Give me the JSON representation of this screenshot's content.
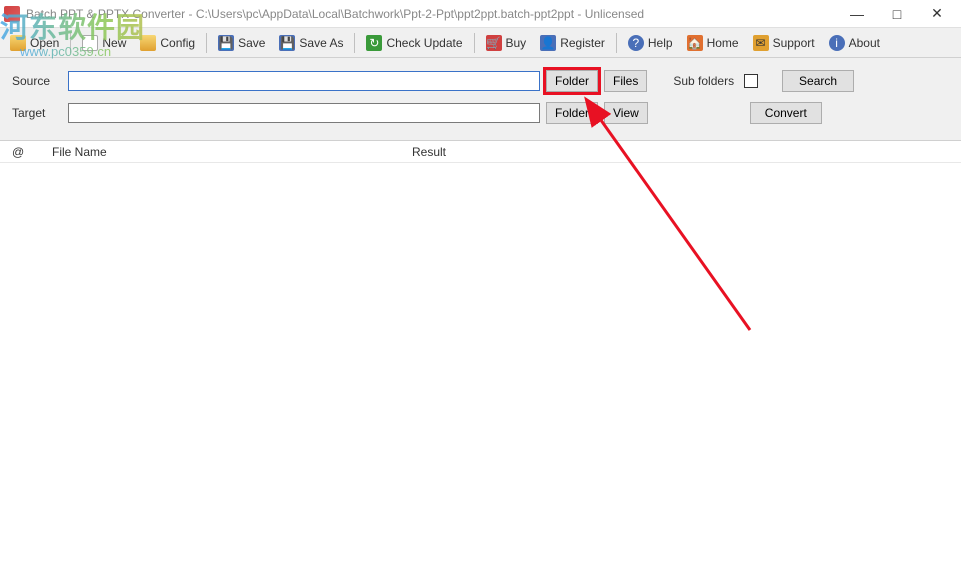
{
  "title": "Batch PPT & PPTX Converter - C:\\Users\\pc\\AppData\\Local\\Batchwork\\Ppt-2-Ppt\\ppt2ppt.batch-ppt2ppt - Unlicensed",
  "toolbar": {
    "open": "Open",
    "new": "New",
    "config": "Config",
    "save": "Save",
    "saveas": "Save As",
    "checkupdate": "Check Update",
    "buy": "Buy",
    "register": "Register",
    "help": "Help",
    "home": "Home",
    "support": "Support",
    "about": "About"
  },
  "form": {
    "source_label": "Source",
    "target_label": "Target",
    "source_value": "",
    "target_value": "",
    "folder_btn": "Folder",
    "files_btn": "Files",
    "view_btn": "View",
    "subfolders_label": "Sub folders",
    "search_btn": "Search",
    "convert_btn": "Convert"
  },
  "list": {
    "col_at": "@",
    "col_name": "File Name",
    "col_result": "Result"
  },
  "watermark": {
    "line1": "河东软件园",
    "line2": "www.pc0359.cn"
  }
}
